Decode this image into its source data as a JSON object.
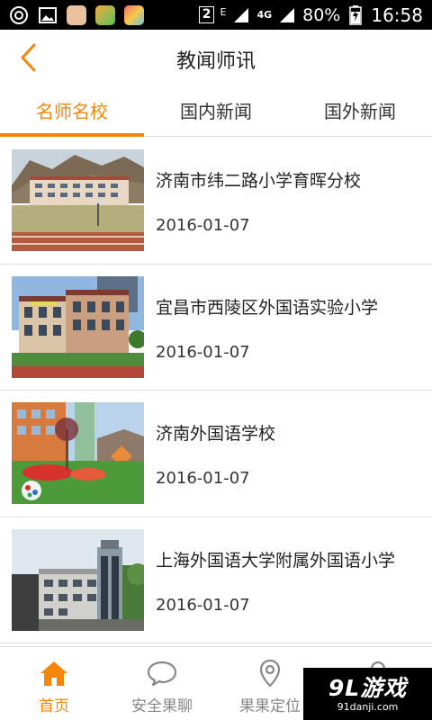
{
  "status_bar": {
    "sim_badge": "2",
    "network_e": "E",
    "network_4g": "4G",
    "battery": "80%",
    "time": "16:58",
    "icons": [
      "tether-icon",
      "gallery-icon",
      "app-icon-1",
      "app-icon-2",
      "app-icon-3"
    ]
  },
  "header": {
    "title": "教闻师讯"
  },
  "tabs": [
    {
      "label": "名师名校",
      "active": true
    },
    {
      "label": "国内新闻",
      "active": false
    },
    {
      "label": "国外新闻",
      "active": false
    }
  ],
  "news": [
    {
      "title": "济南市纬二路小学育晖分校",
      "date": "2016-01-07"
    },
    {
      "title": "宜昌市西陵区外国语实验小学",
      "date": "2016-01-07"
    },
    {
      "title": "济南外国语学校",
      "date": "2016-01-07"
    },
    {
      "title": "上海外国语大学附属外国语小学",
      "date": "2016-01-07"
    }
  ],
  "bottom_nav": [
    {
      "label": "首页",
      "icon": "home-icon",
      "active": true
    },
    {
      "label": "安全果聊",
      "icon": "chat-icon",
      "active": false
    },
    {
      "label": "果果定位",
      "icon": "location-pin-icon",
      "active": false
    },
    {
      "label": "",
      "icon": "profile-icon",
      "active": false
    }
  ],
  "watermark": {
    "logo": "9L游戏",
    "url": "91danji.com"
  },
  "colors": {
    "accent": "#f3860b",
    "status_bar": "#000000",
    "inactive": "#888888"
  }
}
